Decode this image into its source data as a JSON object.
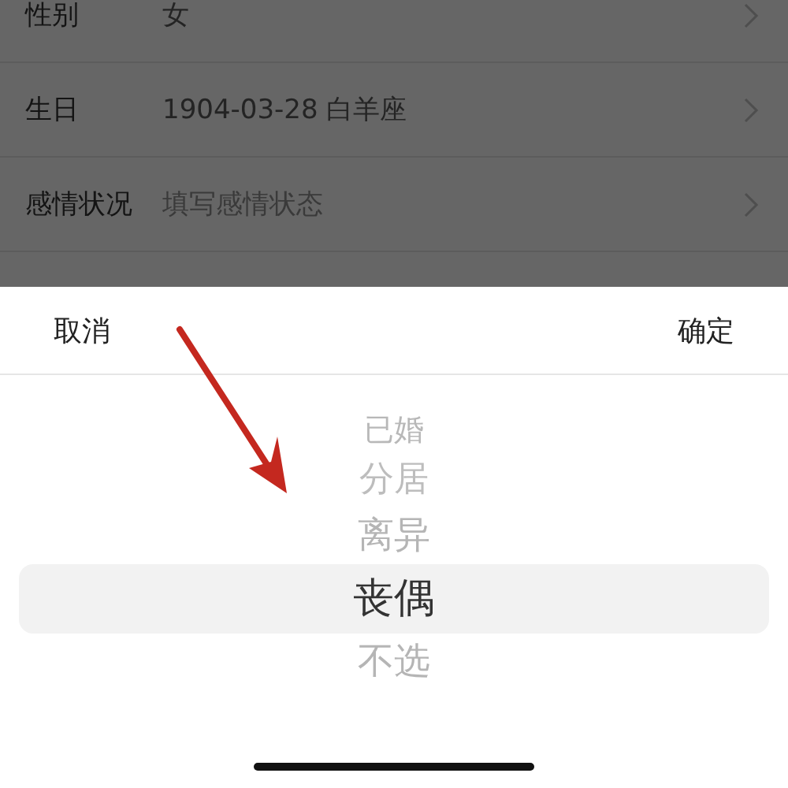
{
  "profile_rows": [
    {
      "label": "性别",
      "value": "女"
    },
    {
      "label": "生日",
      "value": "1904-03-28 白羊座"
    },
    {
      "label": "感情状况",
      "placeholder": "填写感情状态"
    }
  ],
  "picker": {
    "cancel": "取消",
    "confirm": "确定",
    "options": [
      {
        "label": "已婚",
        "selected": false
      },
      {
        "label": "分居",
        "selected": false
      },
      {
        "label": "离异",
        "selected": false
      },
      {
        "label": "丧偶",
        "selected": true
      },
      {
        "label": "不选",
        "selected": false
      }
    ]
  }
}
